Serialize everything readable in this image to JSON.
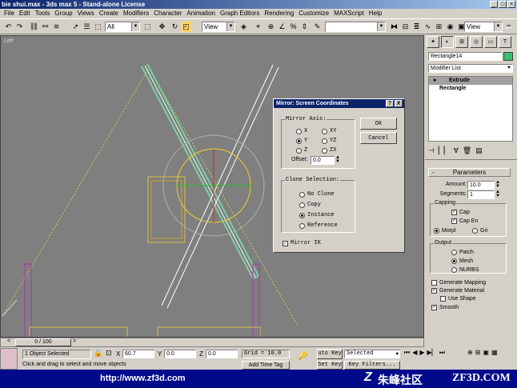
{
  "window": {
    "title": "bie shui.max - 3ds max 5 - Stand-alone License",
    "btn_min": "_",
    "btn_max": "□",
    "btn_close": "×"
  },
  "menu": [
    "File",
    "Edit",
    "Tools",
    "Group",
    "Views",
    "Create",
    "Modifiers",
    "Character",
    "Animation",
    "Graph Editors",
    "Rendering",
    "Customize",
    "MAXScript",
    "Help"
  ],
  "toolbar": {
    "selection_filter": "All",
    "ref_coord": "View",
    "named_sel": "",
    "render_view": "View"
  },
  "viewport": {
    "label": "Left"
  },
  "panel": {
    "object_name": "Rectangle14",
    "modifier_list": "Modifier List",
    "stack": [
      {
        "label": "Extrude",
        "selected": true
      },
      {
        "label": "Rectangle",
        "selected": false
      }
    ],
    "params_title": "Parameters",
    "amount_label": "Amount:",
    "amount_value": "10.0",
    "segments_label": "Segments:",
    "segments_value": "1",
    "capping_label": "Capping",
    "cap_start": "Cap",
    "cap_end": "Cap En",
    "morph": "Morpl",
    "grid": "Gri",
    "output_label": "Output",
    "output_options": [
      "Patch",
      "Mesh",
      "NURBS"
    ],
    "gen_mapping": "Generate Mapping",
    "gen_material": "Generate Material",
    "use_shape": "Use Shape",
    "smooth": "Smooth"
  },
  "dialog": {
    "title": "Mirror: Screen Coordinates",
    "help": "?",
    "close": "X",
    "mirror_axis_label": "Mirror Axis:",
    "axes": [
      "X",
      "Y",
      "Z",
      "XY",
      "YZ",
      "ZX"
    ],
    "selected_axis": "Y",
    "offset_label": "Offset:",
    "offset_value": "0.0",
    "clone_label": "Clone Selection:",
    "clone_options": [
      "No Clone",
      "Copy",
      "Instance",
      "Reference"
    ],
    "selected_clone": "Instance",
    "mirror_ik": "Mirror IK",
    "ok": "OK",
    "cancel": "Cancel"
  },
  "bottom": {
    "time": "0 / 100",
    "status": "1 Object Selected",
    "prompt": "Click and drag to select and move objects",
    "x_label": "X",
    "x_value": "60.7",
    "y_label": "Y",
    "y_value": "0.0",
    "z_label": "Z",
    "z_value": "0.0",
    "grid": "Grid = 10.0",
    "add_time_tag": "Add Time Tag",
    "auto_key": "uto Key",
    "set_key": "Set Key",
    "selected": "Selected",
    "key_filters": "Key Filters..."
  },
  "footer": {
    "url": "http://www.zf3d.com",
    "brand": "朱峰社区",
    "brand2": "ZF3D.COM"
  }
}
